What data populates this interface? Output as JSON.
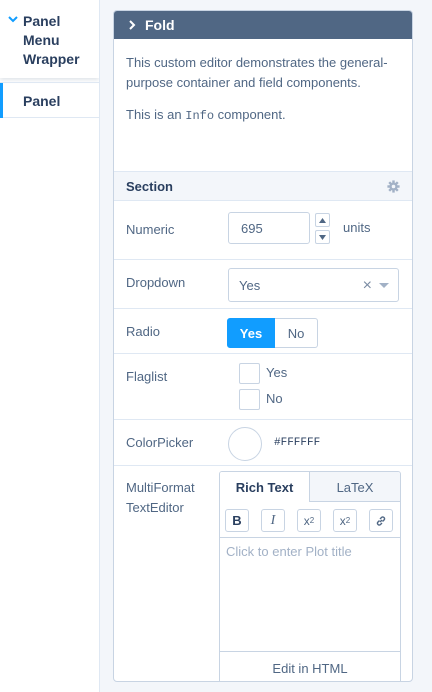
{
  "sidebar": {
    "group_label": "Panel Menu Wrapper",
    "items": [
      {
        "label": "Panel",
        "active": true
      }
    ]
  },
  "fold": {
    "title": "Fold",
    "info": {
      "paragraph1": "This custom editor demonstrates the general-purpose container and field components.",
      "paragraph2_prefix": "This is an ",
      "paragraph2_code": "Info",
      "paragraph2_suffix": " component."
    },
    "section": {
      "title": "Section"
    },
    "fields": {
      "numeric": {
        "label": "Numeric",
        "value": "695",
        "units": "units"
      },
      "dropdown": {
        "label": "Dropdown",
        "value": "Yes",
        "clear_glyph": "×"
      },
      "radio": {
        "label": "Radio",
        "options": [
          "Yes",
          "No"
        ],
        "selected": "Yes"
      },
      "flaglist": {
        "label": "Flaglist",
        "options": [
          "Yes",
          "No"
        ]
      },
      "colorpicker": {
        "label": "ColorPicker",
        "value": "#FFFFFF"
      },
      "multiformat": {
        "label_line1": "MultiFormat",
        "label_line2": "TextEditor",
        "tabs": [
          "Rich Text",
          "LaTeX"
        ],
        "toolbar": {
          "bold": "B",
          "italic": "I",
          "sub_base": "x",
          "sub": "2",
          "sup_base": "x",
          "sup": "2"
        },
        "placeholder": "Click to enter Plot title",
        "footer": "Edit in HTML"
      }
    }
  },
  "colors": {
    "accent": "#119dff",
    "header_bg": "#506784",
    "text": "#506784",
    "heading": "#2a3f5f",
    "border": "#c8d4e3",
    "panel_bg": "#f3f6fa"
  }
}
